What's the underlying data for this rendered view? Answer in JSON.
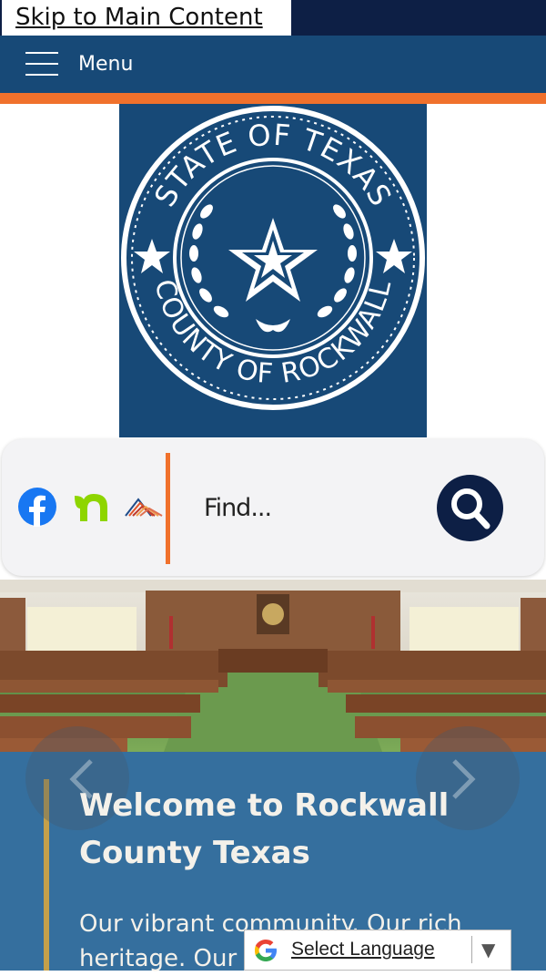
{
  "skip_link": "Skip to Main Content",
  "menu": {
    "label": "Menu"
  },
  "logo": {
    "ring_top": "STATE OF TEXAS",
    "ring_bottom": "COUNTY OF ROCKWALL"
  },
  "social": [
    {
      "name": "facebook",
      "icon": "facebook-icon",
      "color": "#1877f2"
    },
    {
      "name": "nextdoor",
      "icon": "nextdoor-icon",
      "color": "#8ed500"
    },
    {
      "name": "county-app",
      "icon": "county-app-icon",
      "color": "#e0552a"
    }
  ],
  "search": {
    "placeholder": "Find..."
  },
  "hero": {
    "title": "Welcome to Rockwall County Texas",
    "description": "Our vibrant community. Our rich heritage. Our"
  },
  "translate": {
    "label": "Select Language",
    "caret": "▼"
  },
  "colors": {
    "navy": "#0d1f45",
    "blue": "#174977",
    "orange": "#f0712c",
    "panel": "#356f9e",
    "gold": "#c4a04a"
  }
}
